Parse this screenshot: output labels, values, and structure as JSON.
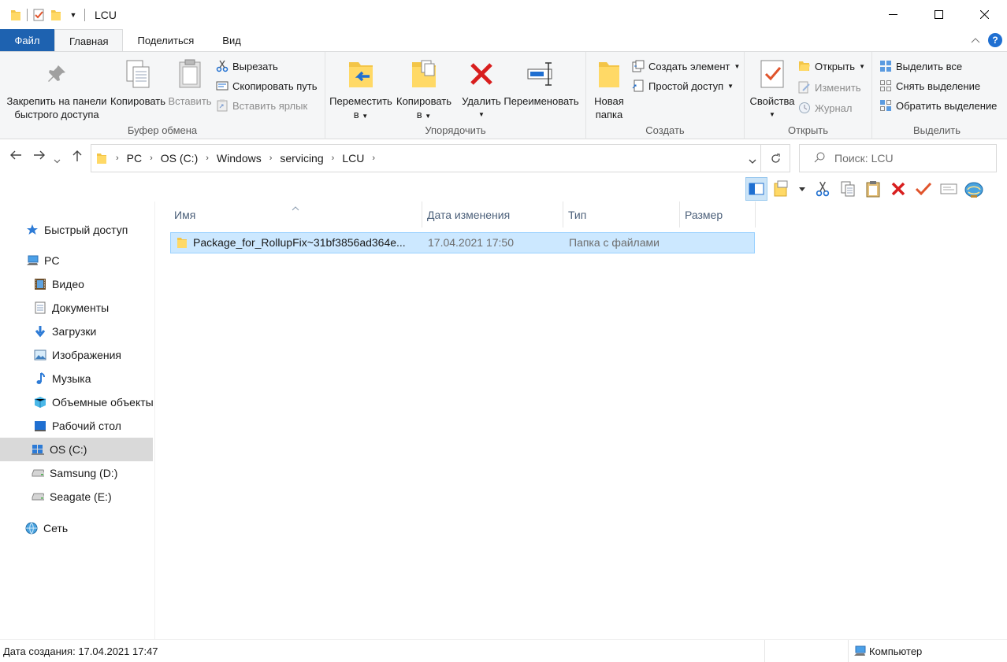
{
  "window": {
    "title": "LCU"
  },
  "ribbon_tabs": [
    "Файл",
    "Главная",
    "Поделиться",
    "Вид"
  ],
  "ribbon": {
    "clipboard": {
      "pin": "Закрепить на панели быстрого доступа",
      "pin_l1": "Закрепить на панели",
      "pin_l2": "быстрого доступа",
      "copy": "Копировать",
      "paste": "Вставить",
      "cut": "Вырезать",
      "copy_path": "Скопировать путь",
      "paste_shortcut": "Вставить ярлык",
      "label": "Буфер обмена"
    },
    "organize": {
      "move_l1": "Переместить",
      "move_l2": "в",
      "copyto_l1": "Копировать",
      "copyto_l2": "в",
      "delete": "Удалить",
      "rename": "Переименовать",
      "label": "Упорядочить"
    },
    "new": {
      "folder_l1": "Новая",
      "folder_l2": "папка",
      "new_item": "Создать элемент",
      "easy_access": "Простой доступ",
      "label": "Создать"
    },
    "open": {
      "properties": "Свойства",
      "open": "Открыть",
      "edit": "Изменить",
      "history": "Журнал",
      "label": "Открыть"
    },
    "select": {
      "select_all": "Выделить все",
      "select_none": "Снять выделение",
      "invert": "Обратить выделение",
      "label": "Выделить"
    }
  },
  "address": {
    "crumbs": [
      "PC",
      "OS (C:)",
      "Windows",
      "servicing",
      "LCU"
    ],
    "search_placeholder": "Поиск: LCU"
  },
  "nav": {
    "quick_access": "Быстрый доступ",
    "pc": "PC",
    "video": "Видео",
    "documents": "Документы",
    "downloads": "Загрузки",
    "pictures": "Изображения",
    "music": "Музыка",
    "objects3d": "Объемные объекты",
    "desktop": "Рабочий стол",
    "drive_c": "OS (C:)",
    "drive_d": "Samsung (D:)",
    "drive_e": "Seagate (E:)",
    "network": "Сеть"
  },
  "columns": {
    "name": "Имя",
    "date": "Дата изменения",
    "type": "Тип",
    "size": "Размер"
  },
  "files": [
    {
      "name": "Package_for_RollupFix~31bf3856ad364e...",
      "date": "17.04.2021 17:50",
      "type": "Папка с файлами",
      "size": ""
    }
  ],
  "status": {
    "left": "Дата создания: 17.04.2021 17:47",
    "right": "Компьютер"
  },
  "colors": {
    "file_tab": "#1e62b0",
    "selection": "#cce8ff",
    "accent": "#0078d7"
  }
}
